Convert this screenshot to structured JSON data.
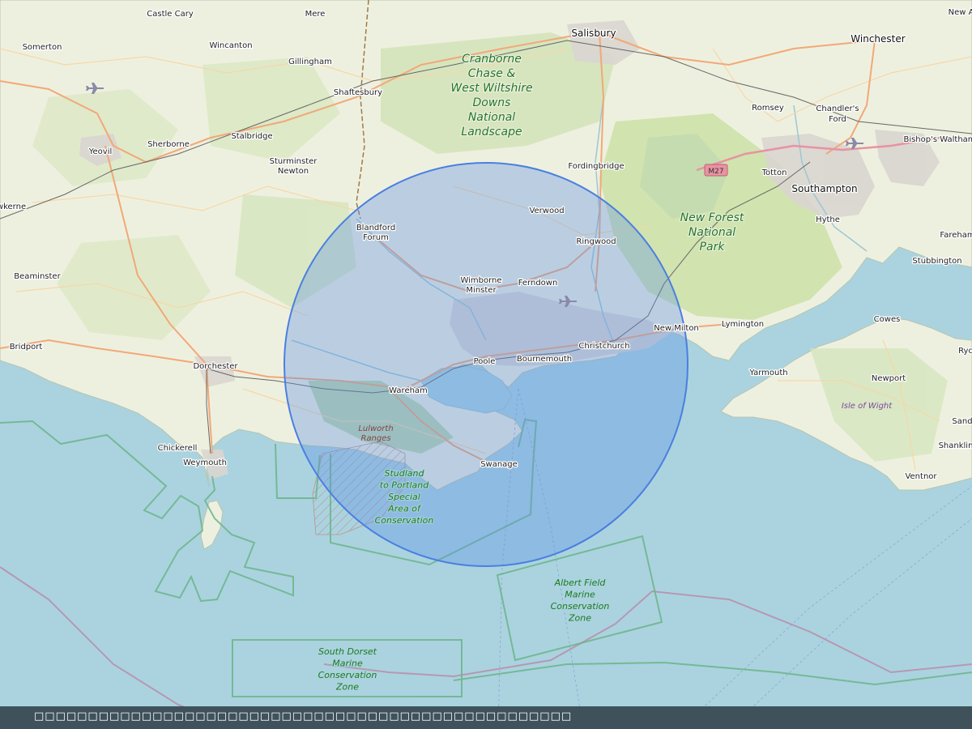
{
  "map": {
    "towns": [
      {
        "name": "Castle Cary"
      },
      {
        "name": "Mere"
      },
      {
        "name": "Salisbury"
      },
      {
        "name": "Winchester"
      },
      {
        "name": "New Alr"
      },
      {
        "name": "Somerton"
      },
      {
        "name": "Wincanton"
      },
      {
        "name": "Gillingham"
      },
      {
        "name": "Shaftesbury"
      },
      {
        "name": "Romsey"
      },
      {
        "name": "Chandler's"
      },
      {
        "name": "Ford"
      },
      {
        "name": "Bishop's Waltham"
      },
      {
        "name": "Yeovil"
      },
      {
        "name": "Sherborne"
      },
      {
        "name": "Stalbridge"
      },
      {
        "name": "Sturminster"
      },
      {
        "name": "Newton"
      },
      {
        "name": "Fordingbridge"
      },
      {
        "name": "Totton"
      },
      {
        "name": "Southampton"
      },
      {
        "name": "wkerne"
      },
      {
        "name": "Verwood"
      },
      {
        "name": "Hythe"
      },
      {
        "name": "Fareham"
      },
      {
        "name": "Blandford"
      },
      {
        "name": "Forum"
      },
      {
        "name": "Ringwood"
      },
      {
        "name": "Stubbington"
      },
      {
        "name": "Beaminster"
      },
      {
        "name": "Wimborne"
      },
      {
        "name": "Minster"
      },
      {
        "name": "Ferndown"
      },
      {
        "name": "Cowes"
      },
      {
        "name": "Lymington"
      },
      {
        "name": "New Milton"
      },
      {
        "name": "Ryc"
      },
      {
        "name": "Bridport"
      },
      {
        "name": "Christchurch"
      },
      {
        "name": "Bournemouth"
      },
      {
        "name": "Poole"
      },
      {
        "name": "Dorchester"
      },
      {
        "name": "Yarmouth"
      },
      {
        "name": "Newport"
      },
      {
        "name": "Wareham"
      },
      {
        "name": "Sand"
      },
      {
        "name": "Chickerell"
      },
      {
        "name": "Swanage"
      },
      {
        "name": "Shanklin"
      },
      {
        "name": "Weymouth"
      },
      {
        "name": "Ventnor"
      }
    ],
    "park_labels": [
      {
        "lines": [
          "Cranborne",
          "Chase &",
          "West Wiltshire",
          "Downs",
          "National",
          "Landscape"
        ]
      },
      {
        "lines": [
          "New Forest",
          "National",
          "Park"
        ]
      }
    ],
    "conservation_labels": [
      {
        "lines": [
          "Studland",
          "to Portland",
          "Special",
          "Area of",
          "Conservation"
        ]
      },
      {
        "lines": [
          "Albert Field",
          "Marine",
          "Conservation",
          "Zone"
        ]
      },
      {
        "lines": [
          "South Dorset",
          "Marine",
          "Conservation",
          "Zone"
        ]
      }
    ],
    "area_labels": [
      {
        "lines": [
          "Lulworth",
          "Ranges"
        ]
      },
      {
        "lines": [
          "Isle of Wight"
        ]
      }
    ],
    "road_shields": [
      "M27"
    ],
    "radius_circle": {
      "color": "#4a7fe0",
      "fill": "#5b8ee6",
      "fill_opacity": 0.35
    },
    "colors": {
      "sea": "#aad3df",
      "land": "#f2efe9",
      "forest": "#add19e",
      "park": "#c8df9f",
      "urban": "#dddddd",
      "road_major": "#f2a878",
      "road_trunk": "#f9b29c",
      "mcz_boundary": "#6cb48a",
      "county_border": "#9e7a4a"
    }
  },
  "footer": {
    "text": "□□□□□□□□□□□□□□□□□□□□□□□□□□□□□□□□□□□□□□□□□□□□□□□□□□"
  }
}
